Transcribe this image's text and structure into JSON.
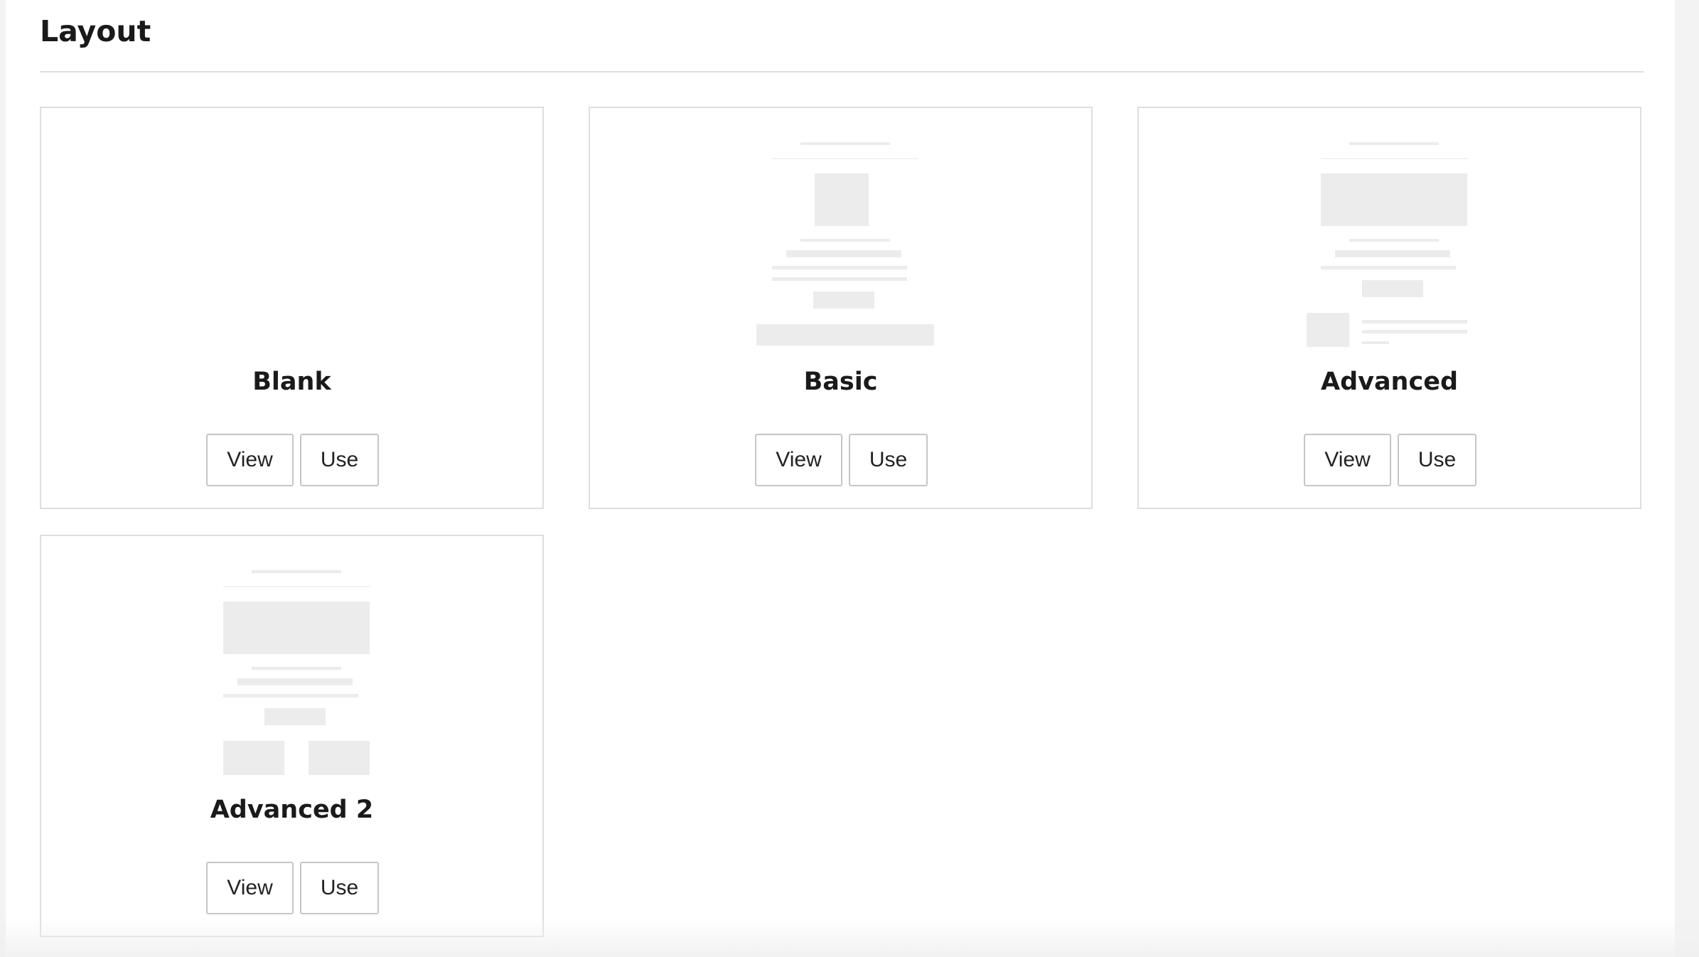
{
  "page": {
    "heading": "Layout"
  },
  "layouts": [
    {
      "title": "Blank",
      "view_label": "View",
      "use_label": "Use"
    },
    {
      "title": "Basic",
      "view_label": "View",
      "use_label": "Use"
    },
    {
      "title": "Advanced",
      "view_label": "View",
      "use_label": "Use"
    },
    {
      "title": "Advanced 2",
      "view_label": "View",
      "use_label": "Use"
    }
  ],
  "colors": {
    "background": "#f3f3f3",
    "panel": "#ffffff",
    "border": "#dedede",
    "placeholder_block": "#ececec",
    "text": "#1a1a1a"
  }
}
